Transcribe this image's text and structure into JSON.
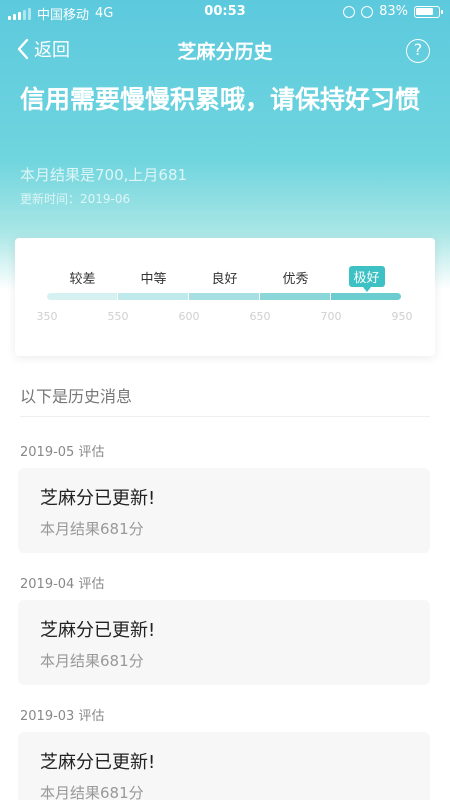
{
  "status_bar": {
    "carrier": "中国移动",
    "network": "4G",
    "time": "00:53",
    "battery": "83%",
    "battery_level": 0.83
  },
  "nav": {
    "back_label": "返回",
    "title": "芝麻分历史",
    "help_symbol": "?"
  },
  "header": {
    "headline": "信用需要慢慢积累哦，请保持好习惯",
    "result_text": "本月结果是700,上月681",
    "update_time": "更新时间：2019-06"
  },
  "score_card": {
    "levels": [
      "较差",
      "中等",
      "良好",
      "优秀",
      "极好"
    ],
    "active_level_index": 4,
    "ticks": [
      "350",
      "550",
      "600",
      "650",
      "700",
      "950"
    ],
    "score": 700,
    "segment_colors": [
      "#d6f1f1",
      "#bfe9ea",
      "#a6e0e2",
      "#8ad6d9",
      "#6ccdd1"
    ]
  },
  "section_title": "以下是历史消息",
  "history": [
    {
      "date": "2019-05 评估",
      "title": "芝麻分已更新!",
      "subtitle": "本月结果681分"
    },
    {
      "date": "2019-04 评估",
      "title": "芝麻分已更新!",
      "subtitle": "本月结果681分"
    },
    {
      "date": "2019-03 评估",
      "title": "芝麻分已更新!",
      "subtitle": "本月结果681分"
    }
  ],
  "colors": {
    "header_gradient_top": "#5cc9dd",
    "accent": "#3ec1c4",
    "card_background": "#f7f7f7"
  }
}
